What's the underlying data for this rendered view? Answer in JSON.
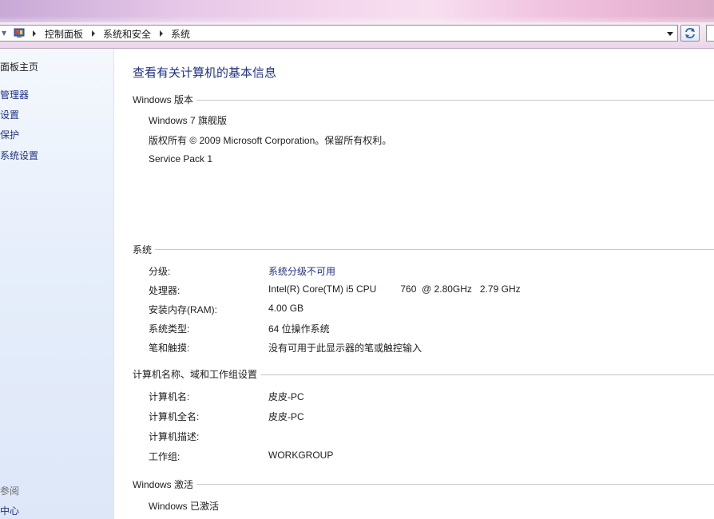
{
  "breadcrumb": {
    "items": [
      "控制面板",
      "系统和安全",
      "系统"
    ]
  },
  "sidebar": {
    "home": "面板主页",
    "links": [
      "管理器",
      "设置",
      "保护",
      "系统设置"
    ],
    "see_also_header": "参阅",
    "see_also": [
      "中心"
    ]
  },
  "main": {
    "title": "查看有关计算机的基本信息",
    "windows_edition": {
      "heading": "Windows 版本",
      "edition": "Windows 7 旗舰版",
      "copyright": "版权所有 © 2009 Microsoft Corporation。保留所有权利。",
      "service_pack": "Service Pack 1"
    },
    "system": {
      "heading": "系统",
      "rows": [
        {
          "label": "分级:",
          "value": "系统分级不可用",
          "link": true
        },
        {
          "label": "处理器:",
          "value": "Intel(R) Core(TM) i5 CPU         760  @ 2.80GHz   2.79 GHz",
          "link": false
        },
        {
          "label": "安装内存(RAM):",
          "value": "4.00 GB",
          "link": false
        },
        {
          "label": "系统类型:",
          "value": "64 位操作系统",
          "link": false
        },
        {
          "label": "笔和触摸:",
          "value": "没有可用于此显示器的笔或触控输入",
          "link": false
        }
      ]
    },
    "computer_name": {
      "heading": "计算机名称、域和工作组设置",
      "rows": [
        {
          "label": "计算机名:",
          "value": "皮皮-PC"
        },
        {
          "label": "计算机全名:",
          "value": "皮皮-PC"
        },
        {
          "label": "计算机描述:",
          "value": ""
        },
        {
          "label": "工作组:",
          "value": "WORKGROUP"
        }
      ]
    },
    "activation": {
      "heading": "Windows 激活",
      "status": "Windows 已激活"
    }
  },
  "colors": {
    "link_blue": "#1e3287",
    "sidebar_bg": "#e6eefb"
  }
}
